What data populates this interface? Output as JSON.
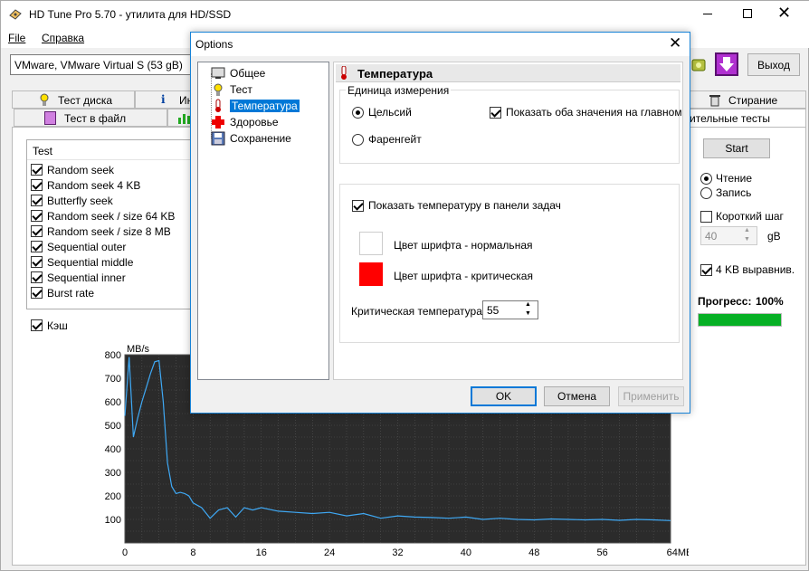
{
  "main_window": {
    "title": "HD Tune Pro 5.70 - утилита для HD/SSD",
    "menu": [
      "File",
      "Справка"
    ],
    "drive_select": "VMware, VMware Virtual S (53 gB)",
    "exit_label": "Выход",
    "tabs_row1": [
      "Тест диска",
      "Ин",
      "Стирание"
    ],
    "tabs_row2": [
      "Тест в файл",
      "ительные тесты"
    ],
    "test_list": {
      "header": "Test",
      "items": [
        {
          "label": "Random seek",
          "checked": true
        },
        {
          "label": "Random seek 4 KB",
          "checked": true
        },
        {
          "label": "Butterfly seek",
          "checked": true
        },
        {
          "label": "Random seek / size 64 KB",
          "checked": true
        },
        {
          "label": "Random seek / size 8 MB",
          "checked": true
        },
        {
          "label": "Sequential outer",
          "checked": true
        },
        {
          "label": "Sequential middle",
          "checked": true
        },
        {
          "label": "Sequential inner",
          "checked": true
        },
        {
          "label": "Burst rate",
          "checked": true
        }
      ]
    },
    "cache_label": "Кэш",
    "start_label": "Start",
    "read_label": "Чтение",
    "write_label": "Запись",
    "short_step_label": "Короткий шаг",
    "step_value": "40",
    "step_unit": "gB",
    "align_label": "4 KB выравнив.",
    "progress_label": "Прогресс:",
    "progress_value": "100%",
    "progress_fraction": 1.0,
    "progress_color": "#06b025"
  },
  "chart_data": {
    "type": "line",
    "ylabel": "MB/s",
    "xlabel": "",
    "x_unit": "MB",
    "xlim": [
      0,
      64
    ],
    "ylim": [
      0,
      800
    ],
    "x_ticks": [
      0,
      8,
      16,
      24,
      32,
      40,
      48,
      56,
      64
    ],
    "x_tick_labels": [
      "0",
      "8",
      "16",
      "24",
      "32",
      "40",
      "48",
      "56",
      "64MB"
    ],
    "y_ticks": [
      100,
      200,
      300,
      400,
      500,
      600,
      700,
      800
    ],
    "grid": true,
    "background": "#2b2b2b",
    "line_color": "#3fa9f5",
    "series": [
      {
        "x": [
          0,
          0.5,
          1,
          1.5,
          2,
          2.5,
          3,
          3.5,
          4,
          4.5,
          5,
          5.5,
          6,
          6.5,
          7,
          7.5,
          8,
          9,
          10,
          11,
          12,
          13,
          14,
          15,
          16,
          18,
          20,
          22,
          24,
          26,
          28,
          30,
          32,
          34,
          36,
          38,
          40,
          42,
          44,
          46,
          48,
          50,
          52,
          54,
          56,
          58,
          60,
          62,
          64
        ],
        "y": [
          540,
          790,
          450,
          530,
          600,
          660,
          720,
          770,
          775,
          600,
          340,
          240,
          210,
          215,
          210,
          200,
          170,
          150,
          105,
          140,
          150,
          110,
          150,
          140,
          150,
          135,
          130,
          125,
          130,
          115,
          125,
          105,
          115,
          110,
          108,
          105,
          110,
          100,
          105,
          100,
          98,
          102,
          100,
          98,
          100,
          96,
          100,
          98,
          95
        ]
      }
    ]
  },
  "dialog": {
    "title": "Options",
    "tree": [
      {
        "label": "Общее",
        "icon": "monitor-icon"
      },
      {
        "label": "Тест",
        "icon": "bulb-icon"
      },
      {
        "label": "Температура",
        "icon": "thermometer-icon",
        "selected": true
      },
      {
        "label": "Здоровье",
        "icon": "health-cross-icon"
      },
      {
        "label": "Сохранение",
        "icon": "floppy-icon"
      }
    ],
    "section_title": "Температура",
    "units_group": "Единица измерения",
    "celsius": "Цельсий",
    "fahrenheit": "Фаренгейт",
    "show_both": "Показать оба значения на главном",
    "show_taskbar": "Показать температуру в панели задач",
    "font_normal": "Цвет шрифта - нормальная",
    "font_critical": "Цвет шрифта - критическая",
    "normal_color": "#ffffff",
    "critical_color": "#ff0000",
    "critical_temp_label": "Критическая температура",
    "critical_temp_value": "55",
    "ok": "OK",
    "cancel": "Отмена",
    "apply": "Применить"
  }
}
